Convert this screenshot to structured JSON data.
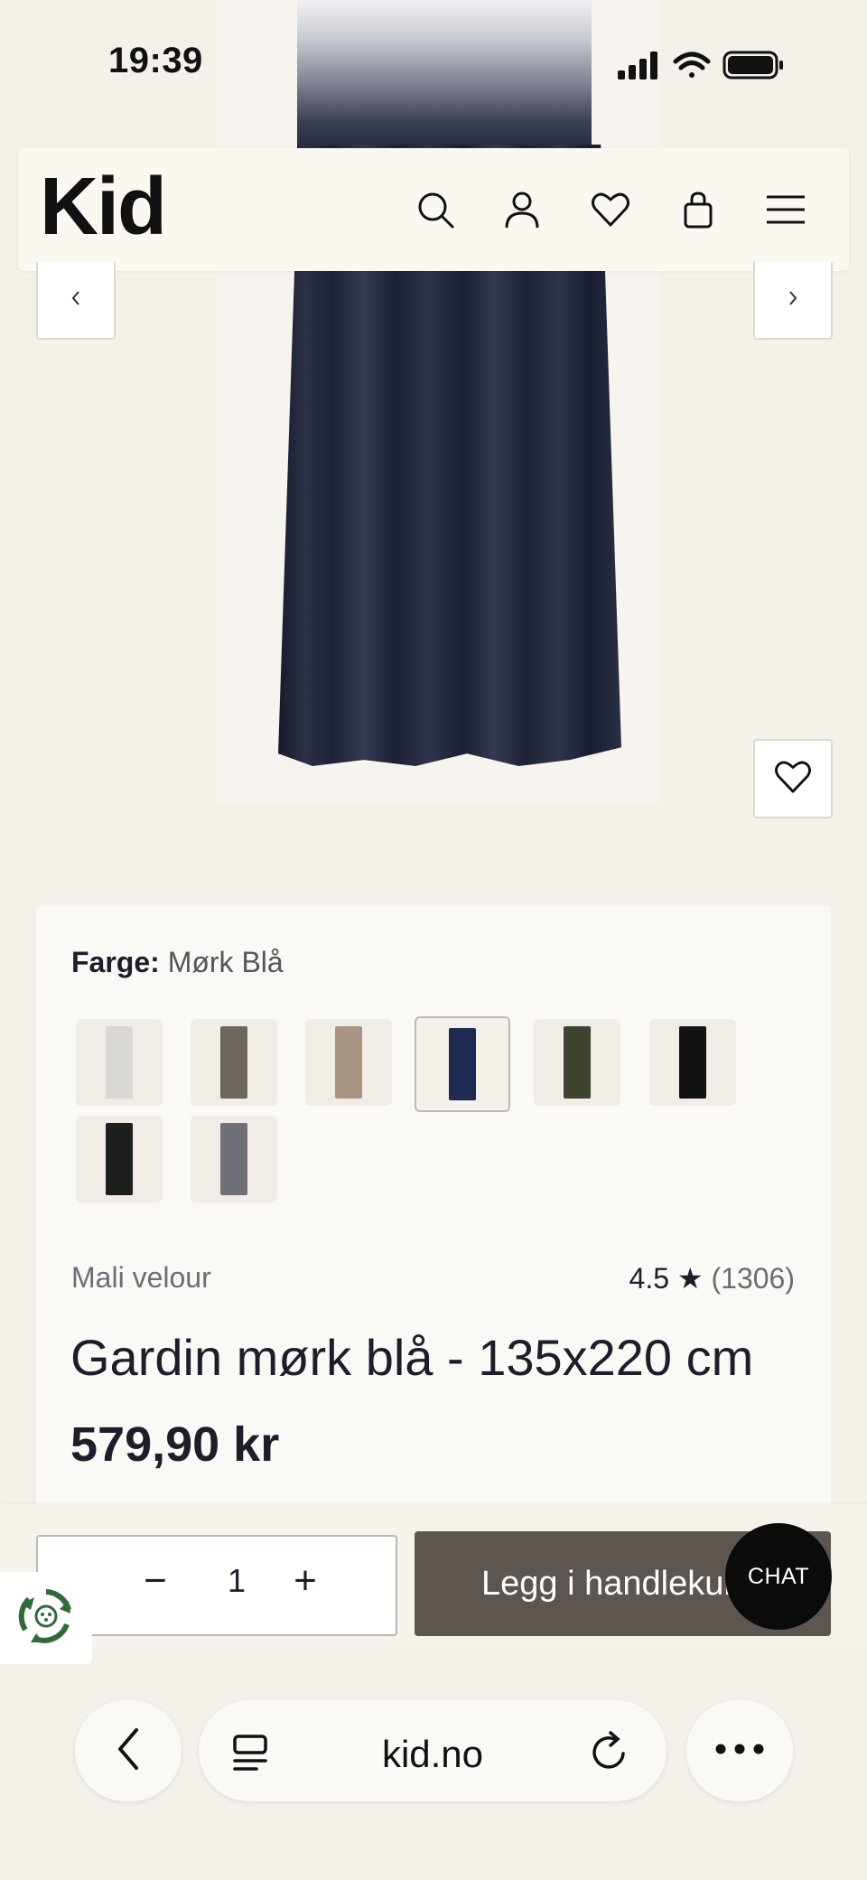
{
  "status_bar": {
    "time": "19:39"
  },
  "header": {
    "logo": "Kid"
  },
  "product": {
    "color_label": "Farge:",
    "color_value": "Mørk Blå",
    "swatches": [
      {
        "color": "#d9d7d4",
        "selected": false
      },
      {
        "color": "#6c6560",
        "selected": false
      },
      {
        "color": "#a89583",
        "selected": false
      },
      {
        "color": "#1e2a4f",
        "selected": true
      },
      {
        "color": "#3f4430",
        "selected": false
      },
      {
        "color": "#131313",
        "selected": false
      },
      {
        "color": "#1d1f1d",
        "selected": false
      },
      {
        "color": "#6f7078",
        "selected": false
      }
    ],
    "brand": "Mali velour",
    "rating": "4.5",
    "rating_star": "★",
    "review_count": "(1306)",
    "title": "Gardin mørk blå - 135x220 cm",
    "price": "579,90 kr"
  },
  "cart": {
    "minus": "−",
    "quantity": "1",
    "plus": "+",
    "add_label": "Legg i handlekurv",
    "chat_label": "CHAT"
  },
  "browser": {
    "url": "kid.no"
  }
}
